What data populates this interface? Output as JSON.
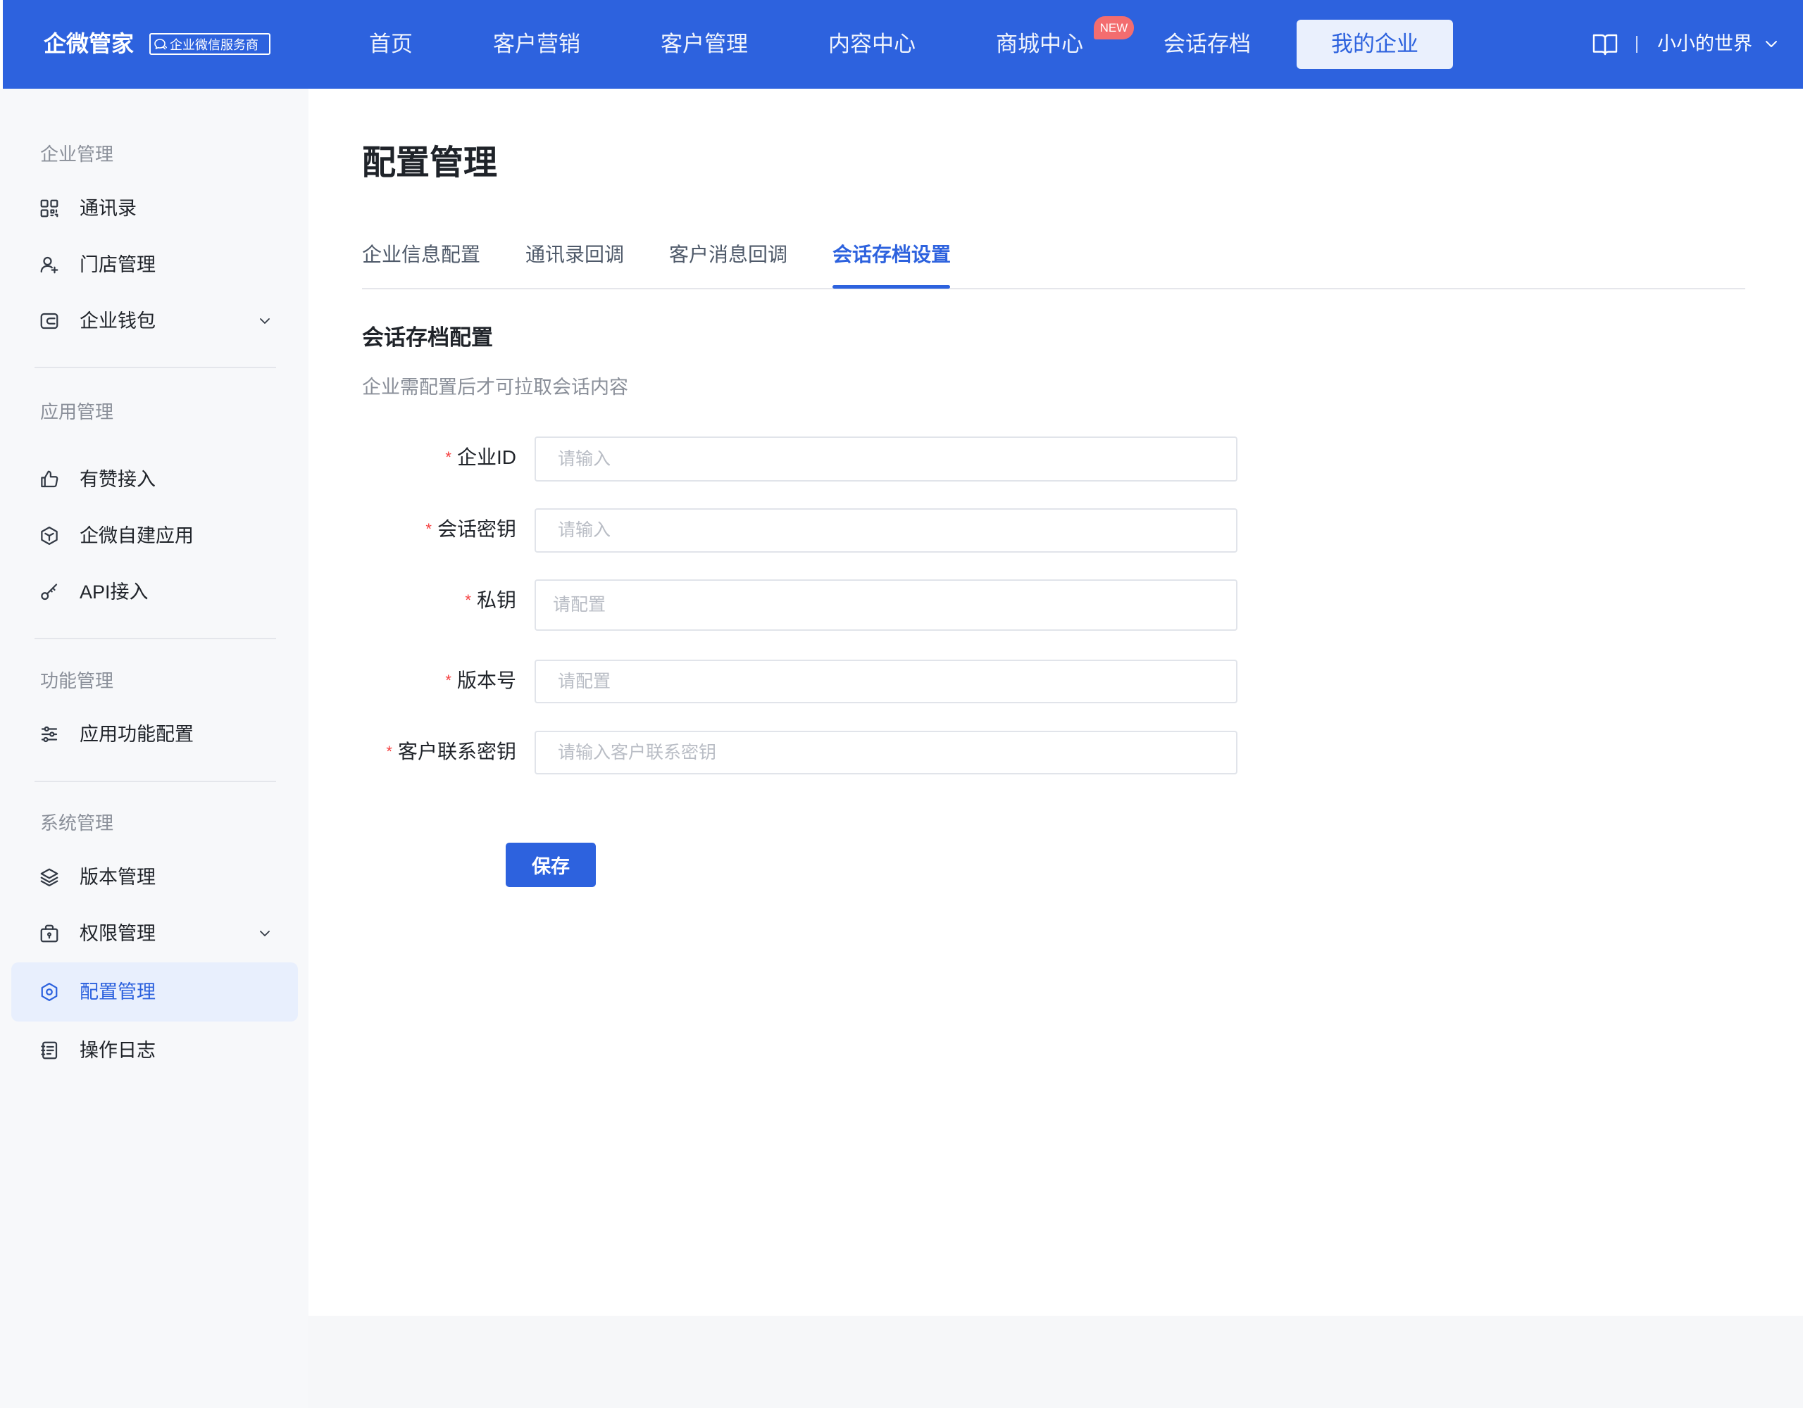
{
  "brand": {
    "name": "企微管家",
    "badge_text": "企业微信服务商",
    "badge_icon": "wechat-work-icon"
  },
  "nav": {
    "items": [
      "首页",
      "客户营销",
      "客户管理",
      "内容中心",
      "商城中心",
      "会话存档"
    ],
    "new_badge": "NEW",
    "active": "我的企业"
  },
  "header_right": {
    "icon": "book-icon",
    "user_name": "小小的世界"
  },
  "sidebar": {
    "sections": [
      {
        "title": "企业管理",
        "items": [
          {
            "label": "通讯录",
            "icon": "grid-icon"
          },
          {
            "label": "门店管理",
            "icon": "user-add-icon"
          },
          {
            "label": "企业钱包",
            "icon": "wallet-icon",
            "expandable": true
          }
        ]
      },
      {
        "title": "应用管理",
        "items": [
          {
            "label": "有赞接入",
            "icon": "thumbs-up-icon"
          },
          {
            "label": "企微自建应用",
            "icon": "cube-icon"
          },
          {
            "label": "API接入",
            "icon": "key-icon"
          }
        ]
      },
      {
        "title": "功能管理",
        "items": [
          {
            "label": "应用功能配置",
            "icon": "sliders-icon"
          }
        ]
      },
      {
        "title": "系统管理",
        "items": [
          {
            "label": "版本管理",
            "icon": "layers-icon"
          },
          {
            "label": "权限管理",
            "icon": "lock-icon",
            "expandable": true
          },
          {
            "label": "配置管理",
            "icon": "settings-icon",
            "active": true
          },
          {
            "label": "操作日志",
            "icon": "log-icon"
          }
        ]
      }
    ]
  },
  "page": {
    "title": "配置管理",
    "tabs": [
      {
        "label": "企业信息配置"
      },
      {
        "label": "通讯录回调"
      },
      {
        "label": "客户消息回调"
      },
      {
        "label": "会话存档设置",
        "active": true
      }
    ]
  },
  "section": {
    "title": "会话存档配置",
    "description": "企业需配置后才可拉取会话内容"
  },
  "form": {
    "required_mark": "*",
    "fields": [
      {
        "label": "企业ID",
        "required": true,
        "value": "",
        "placeholder": "请输入"
      },
      {
        "label": "会话密钥",
        "required": true,
        "value": "",
        "placeholder": "请输入"
      },
      {
        "label": "私钥",
        "required": true,
        "value": "",
        "placeholder": "请配置"
      },
      {
        "label": "版本号",
        "required": true,
        "value": "",
        "placeholder": "请配置"
      },
      {
        "label": "客户联系密钥",
        "required": true,
        "value": "",
        "placeholder": "请输入客户联系密钥"
      }
    ],
    "save_label": "保存"
  },
  "colors": {
    "header_bg": "#2d62de",
    "accent": "#2d62de",
    "active_bg": "#e8effd",
    "required": "#f53f3f",
    "new_badge": "#f36d6f",
    "sidebar_bg": "#f7f8fa"
  }
}
